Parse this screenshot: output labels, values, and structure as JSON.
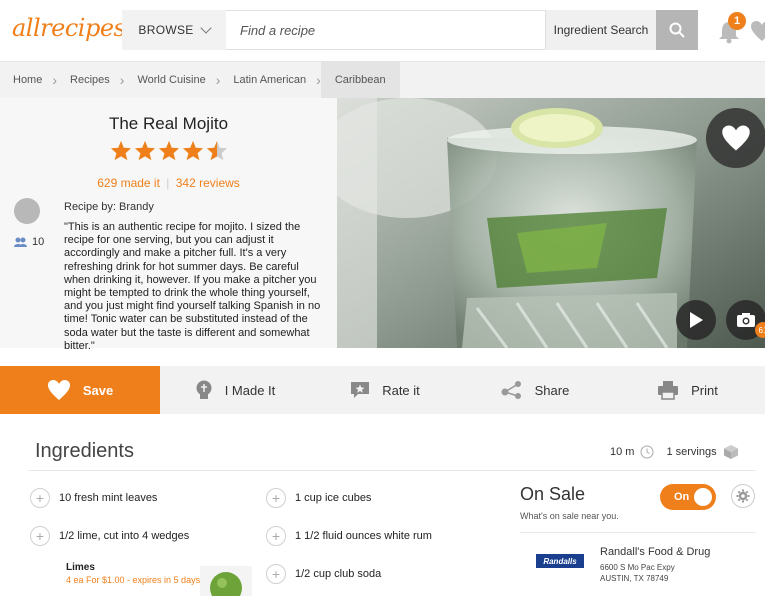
{
  "header": {
    "logo": "allrecipes",
    "browse_label": "BROWSE",
    "search_placeholder": "Find a recipe",
    "ingredient_search_label": "Ingredient Search",
    "notification_count": "1"
  },
  "breadcrumb": [
    "Home",
    "Recipes",
    "World Cuisine",
    "Latin American",
    "Caribbean"
  ],
  "recipe": {
    "title": "The Real Mojito",
    "rating": 4.5,
    "made_it": "629 made it",
    "separator": "|",
    "reviews": "342 reviews",
    "author_prefix": "Recipe by:",
    "author": "Brandy",
    "followers": "10",
    "description": "\"This is an authentic recipe for mojito. I sized the recipe for one serving, but you can adjust it accordingly and make a pitcher full. It's a very refreshing drink for hot summer days. Be careful when drinking it, however. If you make a pitcher you might be tempted to drink the whole thing yourself, and you just might find yourself talking Spanish in no time! Tonic water can be substituted instead of the soda water but the taste is different and somewhat bitter.\"",
    "photo_count": "61"
  },
  "actions": {
    "save": "Save",
    "made": "I Made It",
    "rate": "Rate it",
    "share": "Share",
    "print": "Print"
  },
  "ingredients": {
    "title": "Ingredients",
    "time": "10 m",
    "servings": "1 servings",
    "left": [
      "10 fresh mint leaves",
      "1/2 lime, cut into 4 wedges"
    ],
    "right": [
      "1 cup ice cubes",
      "1 1/2 fluid ounces white rum",
      "1/2 cup club soda"
    ],
    "sale_item": {
      "name": "Limes",
      "detail": "4 ea For $1.00 - expires in 5 days"
    }
  },
  "on_sale": {
    "title": "On Sale",
    "subtitle": "What's on sale near you.",
    "toggle": "On",
    "store_logo": "Randalls",
    "store_name": "Randall's Food & Drug",
    "address_1": "6600 S Mo Pac Expy",
    "address_2": "AUSTIN, TX 78749"
  },
  "colors": {
    "accent": "#ef7f1a",
    "star": "#ef7f1a"
  }
}
